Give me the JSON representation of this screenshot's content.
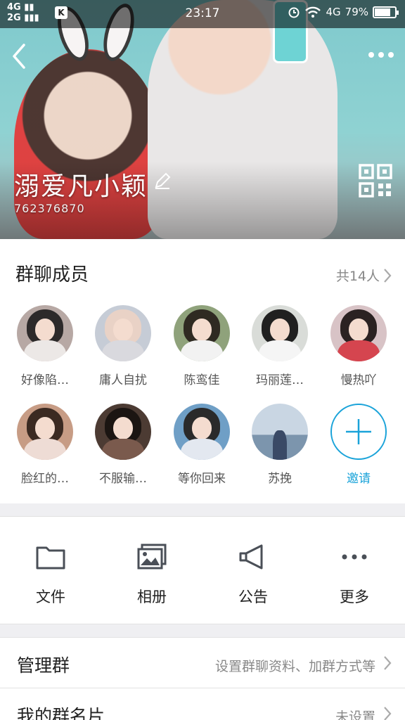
{
  "status_bar": {
    "network_top": "4G",
    "network_bottom": "2G",
    "app_badge": "K",
    "time": "23:17",
    "mobile_data": "4G",
    "battery": "79%",
    "battery_level": 0.79
  },
  "header": {
    "group_name": "溺爱凡小颖",
    "group_id": "762376870"
  },
  "members_section": {
    "title": "群聊成员",
    "count_label": "共14人",
    "members": [
      {
        "name": "好像陷…"
      },
      {
        "name": "庸人自扰"
      },
      {
        "name": "陈鸾佳"
      },
      {
        "name": "玛丽莲…"
      },
      {
        "name": "慢热吖"
      },
      {
        "name": "脸红的…"
      },
      {
        "name": "不服输…"
      },
      {
        "name": "等你回来"
      },
      {
        "name": "苏挽"
      }
    ],
    "invite_label": "邀请"
  },
  "tools": [
    {
      "label": "文件",
      "icon": "folder-icon"
    },
    {
      "label": "相册",
      "icon": "album-icon"
    },
    {
      "label": "公告",
      "icon": "megaphone-icon"
    },
    {
      "label": "更多",
      "icon": "more-dots-icon"
    }
  ],
  "rows": {
    "manage": {
      "title": "管理群",
      "value": "设置群聊资料、加群方式等"
    },
    "my_card": {
      "title": "我的群名片",
      "value": "未设置"
    }
  },
  "colors": {
    "accent": "#1aa3d9",
    "background": "#efeff2"
  }
}
